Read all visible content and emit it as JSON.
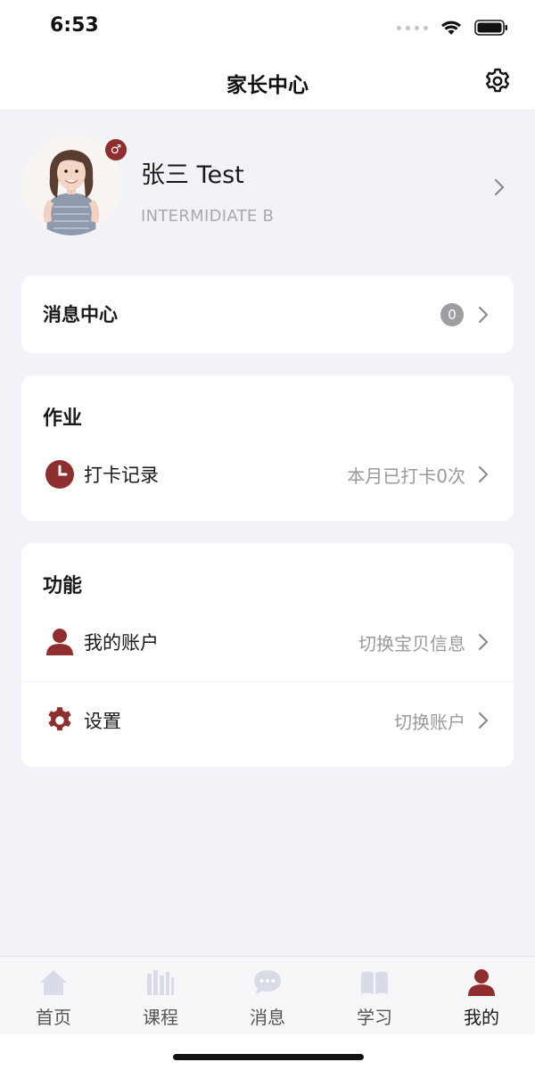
{
  "status_bar": {
    "time": "6:53"
  },
  "header": {
    "title": "家长中心"
  },
  "profile": {
    "name": "张三 Test",
    "level": "INTERMIDIATE B",
    "gender_symbol": "♂"
  },
  "messages": {
    "label": "消息中心",
    "count": "0"
  },
  "homework": {
    "title": "作业",
    "checkin": {
      "label": "打卡记录",
      "value": "本月已打卡0次"
    }
  },
  "functions": {
    "title": "功能",
    "account": {
      "label": "我的账户",
      "value": "切换宝贝信息"
    },
    "settings": {
      "label": "设置",
      "value": "切换账户"
    }
  },
  "tabbar": {
    "tabs": [
      {
        "label": "首页",
        "icon": "home-icon"
      },
      {
        "label": "课程",
        "icon": "books-icon"
      },
      {
        "label": "消息",
        "icon": "chat-bubble-icon"
      },
      {
        "label": "学习",
        "icon": "open-book-icon"
      },
      {
        "label": "我的",
        "icon": "user-icon"
      }
    ],
    "active_index": 4
  },
  "colors": {
    "accent": "#8e2e2e",
    "inactive_icon": "#d9dbe6",
    "background": "#f2f3f7"
  }
}
